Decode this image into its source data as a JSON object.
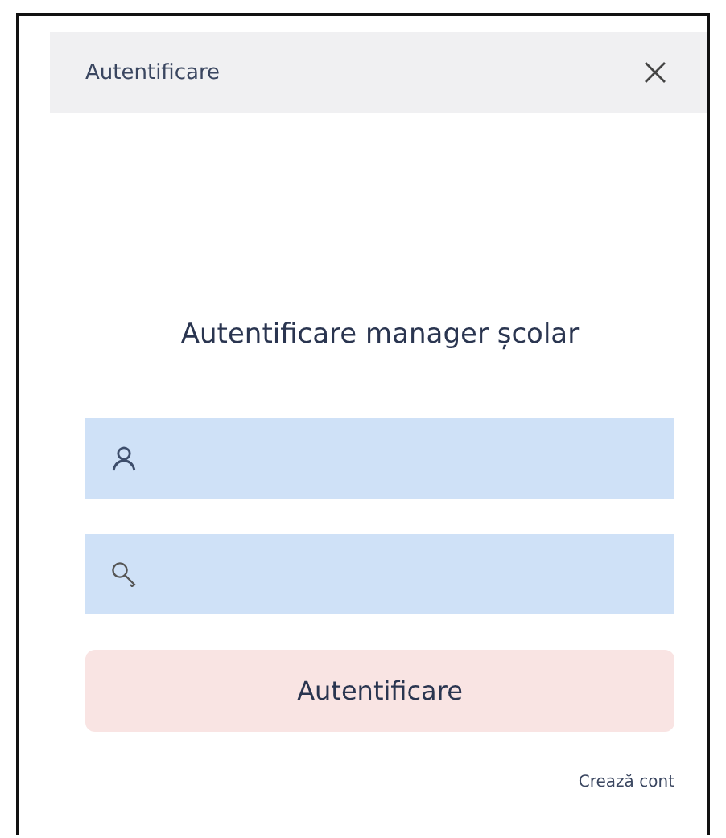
{
  "header": {
    "title": "Autentificare"
  },
  "heading": "Autentificare manager școlar",
  "fields": [
    {
      "kind": "user"
    },
    {
      "kind": "key"
    }
  ],
  "button": "Autentificare",
  "link": "Crează cont"
}
